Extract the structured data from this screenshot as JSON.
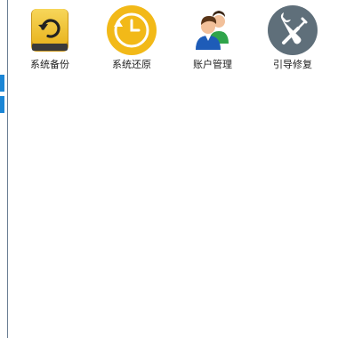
{
  "tools": [
    {
      "label": "系统备份",
      "icon": "backup-drive-icon"
    },
    {
      "label": "系统还原",
      "icon": "restore-clock-icon"
    },
    {
      "label": "账户管理",
      "icon": "users-icon"
    },
    {
      "label": "引导修复",
      "icon": "wrench-screwdriver-icon"
    }
  ],
  "colors": {
    "backup_yellow": "#f5c93b",
    "restore_yellow": "#f2b918",
    "repair_gray": "#5f6f7a",
    "side_tab_blue": "#1b86d6"
  }
}
